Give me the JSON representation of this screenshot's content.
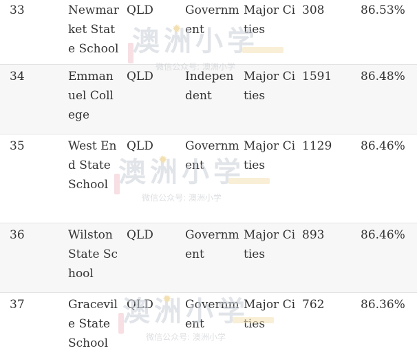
{
  "rows": [
    {
      "rank": "33",
      "school": "Newmarket State School",
      "state": "QLD",
      "sector": "Government",
      "region": "Major Cities",
      "enrolments": "308",
      "score": "86.53%"
    },
    {
      "rank": "34",
      "school": "Emmanuel College",
      "state": "QLD",
      "sector": "Independent",
      "region": "Major Cities",
      "enrolments": "1591",
      "score": "86.48%"
    },
    {
      "rank": "35",
      "school": "West End State School",
      "state": "QLD",
      "sector": "Government",
      "region": "Major Cities",
      "enrolments": "1129",
      "score": "86.46%"
    },
    {
      "rank": "36",
      "school": "Wilston State School",
      "state": "QLD",
      "sector": "Government",
      "region": "Major Cities",
      "enrolments": "893",
      "score": "86.46%"
    },
    {
      "rank": "37",
      "school": "Gracevile State School",
      "state": "QLD",
      "sector": "Government",
      "region": "Major Cities",
      "enrolments": "762",
      "score": "86.36%"
    }
  ],
  "watermark": {
    "logo_text": "澳洲小学",
    "caption": "微信公众号: 澳洲小学"
  }
}
